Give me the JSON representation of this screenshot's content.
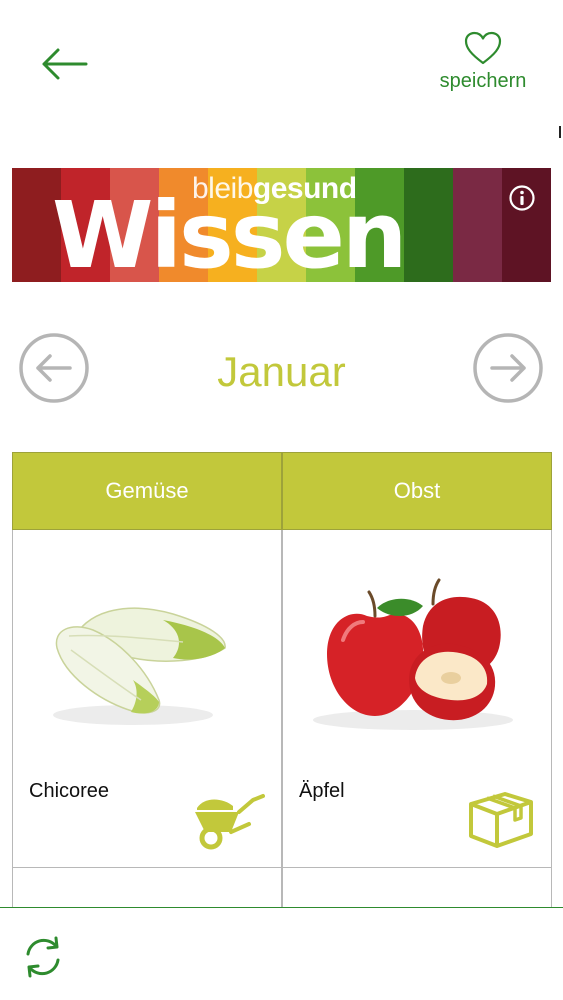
{
  "header": {
    "back_icon": "arrow-left-icon",
    "save_icon": "heart-outline-icon",
    "save_label": "speichern",
    "accent_color": "#2e8b2e"
  },
  "banner": {
    "subtitle_light": "bleib",
    "subtitle_bold": "gesund",
    "title": "Wissen",
    "info_icon": "info-icon",
    "stripe_colors": [
      "#8e1d1f",
      "#c0242a",
      "#d8554b",
      "#f08a2c",
      "#f6b01f",
      "#c6d247",
      "#8cc23a",
      "#4e9a28",
      "#2d6c1c",
      "#7a2944",
      "#5e1324"
    ]
  },
  "month_nav": {
    "prev_icon": "circle-arrow-left-icon",
    "next_icon": "circle-arrow-right-icon",
    "month": "Januar",
    "accent_color": "#c2c83b"
  },
  "tabs": {
    "vegetables": "Gemüse",
    "fruit": "Obst"
  },
  "items": [
    {
      "name": "Chicoree",
      "image": "chicory-image",
      "icon": "wheelbarrow-icon"
    },
    {
      "name": "Äpfel",
      "image": "apples-image",
      "icon": "storage-box-icon"
    }
  ],
  "bottom_bar": {
    "refresh_icon": "refresh-icon"
  }
}
